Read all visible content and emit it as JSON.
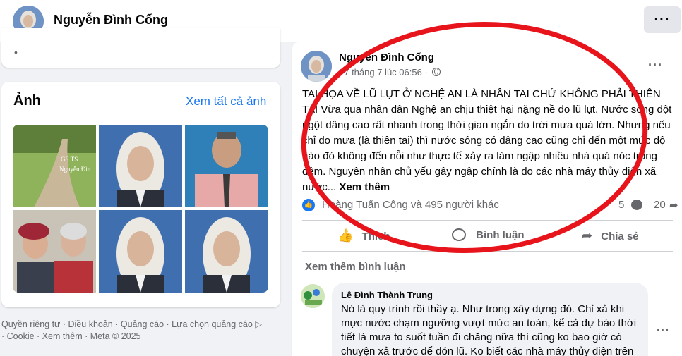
{
  "header": {
    "profile_name": "Nguyễn Đình Cống",
    "more_label": "···"
  },
  "photos": {
    "title": "Ảnh",
    "see_all": "Xem tất cả ảnh",
    "items": [
      {
        "caption": "GS.TS\nNguyễn Đìn"
      },
      {
        "caption": ""
      },
      {
        "caption": ""
      },
      {
        "caption": ""
      },
      {
        "caption": ""
      },
      {
        "caption": ""
      }
    ]
  },
  "footer": {
    "line1": "Quyền riêng tư · Điều khoản · Quảng cáo · Lựa chọn quảng cáo ▷",
    "line2": "· Cookie · Xem thêm · Meta © 2025"
  },
  "post": {
    "author": "Nguyễn Đình Cống",
    "time": "27 tháng 7 lúc 06:56 ·",
    "more_label": "···",
    "headline": "TAI HỌA VỀ LŨ LỤT Ở NGHỆ AN LÀ NHÂN TAI CHỨ KHÔNG PHẢI THIÊN TAI",
    "body": "Vừa qua nhân dân Nghệ an chịu thiệt hại nặng nề do lũ lụt. Nước sông đột ngột dâng cao rất nhanh trong thời gian ngắn do trời mưa quá lớn. Nhưng nếu chỉ do mưa (là thiên tai) thì nước sông có dâng cao cũng chỉ đến một mức độ nào đó không đến nỗi như thực tế xảy ra làm ngập nhiều nhà quá nóc trong đêm. Nguyên nhân chủ yếu gây ngập chính là do các nhà máy thủy điện xã nước...",
    "see_more": "Xem thêm",
    "reactions_text": "Hoàng Tuấn Công và 495 người khác",
    "comment_count": "5",
    "share_count": "20",
    "actions": {
      "like": "Thích",
      "comment": "Bình luận",
      "share": "Chia sẻ"
    },
    "more_comments": "Xem thêm bình luận",
    "comment": {
      "author": "Lê Đình Thành Trung",
      "text": "Nó là quy trình rồi thầy ạ. Như trong xây dựng đó. Chỉ xả khi mực nước chạm ngưỡng vượt mức an toàn, kể cả dự báo thời tiết là mưa to suốt tuần đi chăng nữa thì cũng ko bao giờ có chuyện xả trước để đón lũ. Ko biết các nhà máy thủy điện trên"
    }
  },
  "colors": {
    "accent": "#1877f2",
    "annotation": "#e8141c",
    "background": "#f0f2f5"
  }
}
